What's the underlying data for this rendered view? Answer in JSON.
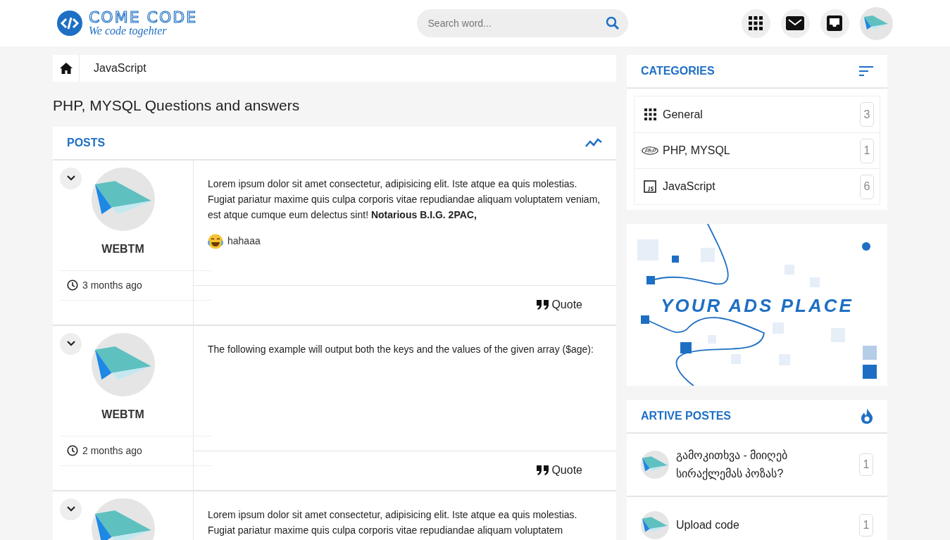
{
  "header": {
    "logo": {
      "title": "COME CODE",
      "tagline": "We code togehter"
    },
    "search": {
      "placeholder": "Search word..."
    }
  },
  "breadcrumb": [
    "JavaScript"
  ],
  "page_title": "PHP, MYSQL Questions and answers",
  "posts_panel": {
    "title": "POSTS",
    "posts": [
      {
        "author": "WEBTM",
        "time": "3 months ago",
        "body": "Lorem ipsum dolor sit amet consectetur, adipisicing elit. Iste atque ea quis molestias. Fugiat pariatur maxime quis culpa corporis vitae repudiandae aliquam voluptatem veniam, est atque cumque eum delectus sint! **Notarious B.I.G. 2PAC,**",
        "reaction": "hahaaa",
        "quote": "Quote"
      },
      {
        "author": "WEBTM",
        "time": "2 months ago",
        "body": "The following example will output both the keys and the values of the given array ($age):",
        "quote": "Quote"
      },
      {
        "body": "Lorem ipsum dolor sit amet consectetur, adipisicing elit. Iste atque ea quis molestias. Fugiat pariatur maxime quis culpa corporis vitae repudiandae aliquam voluptatem"
      }
    ]
  },
  "categories": {
    "title": "CATEGORIES",
    "items": [
      {
        "kind": "grid",
        "label": "General",
        "count": "3"
      },
      {
        "kind": "php",
        "label": "PHP, MYSQL",
        "count": "1"
      },
      {
        "kind": "js",
        "label": "JavaScript",
        "count": "6"
      }
    ]
  },
  "ad": {
    "text": "YOUR ADS PLACE"
  },
  "active_posts": {
    "title": "ARTIVE POSTES",
    "items": [
      {
        "title": "გამოკითხვა - მიიღებ სირაქლემას პოზას?",
        "count": "1"
      },
      {
        "title": "Upload code",
        "count": "1"
      }
    ]
  }
}
